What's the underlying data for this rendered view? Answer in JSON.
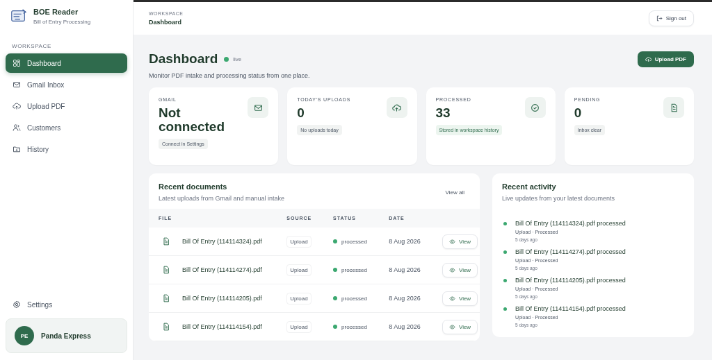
{
  "sidebar": {
    "app_name": "BOE Reader",
    "app_subtitle": "Bill of Entry Processing",
    "section": "WORKSPACE",
    "items": [
      {
        "label": "Dashboard",
        "selected": true
      },
      {
        "label": "Gmail Inbox",
        "selected": false
      },
      {
        "label": "Upload PDF",
        "selected": false
      },
      {
        "label": "Customers",
        "selected": false
      },
      {
        "label": "History",
        "selected": false
      }
    ],
    "settings": "Settings",
    "user": {
      "initials": "PE",
      "name": "Panda Express"
    }
  },
  "header": {
    "breadcrumb": "WORKSPACE",
    "page": "Dashboard",
    "sign_out": "Sign out"
  },
  "hero": {
    "title": "Dashboard",
    "status": "live",
    "subtitle": "Monitor PDF intake and processing status from one place.",
    "upload": "Upload PDF"
  },
  "stats": [
    {
      "label": "GMAIL",
      "value": "Not connected",
      "note": "Connect in Settings",
      "kind": "neutral"
    },
    {
      "label": "TODAY'S UPLOADS",
      "value": "0",
      "note": "No uploads today",
      "kind": "neutral"
    },
    {
      "label": "PROCESSED",
      "value": "33",
      "note": "Stored in workspace history",
      "kind": "positive"
    },
    {
      "label": "PENDING",
      "value": "0",
      "note": "Inbox clear",
      "kind": "neutral"
    }
  ],
  "documents": {
    "title": "Recent documents",
    "subtitle": "Latest uploads from Gmail and manual intake",
    "view_all": "View all",
    "columns": [
      "FILE",
      "SOURCE",
      "STATUS",
      "DATE"
    ],
    "rows": [
      {
        "file": "Bill Of Entry (114114324).pdf",
        "source": "Upload",
        "status": "processed",
        "date": "8 Aug 2026",
        "action": "View"
      },
      {
        "file": "Bill Of Entry (114114274).pdf",
        "source": "Upload",
        "status": "processed",
        "date": "8 Aug 2026",
        "action": "View"
      },
      {
        "file": "Bill Of Entry (114114205).pdf",
        "source": "Upload",
        "status": "processed",
        "date": "8 Aug 2026",
        "action": "View"
      },
      {
        "file": "Bill Of Entry (114114154).pdf",
        "source": "Upload",
        "status": "processed",
        "date": "8 Aug 2026",
        "action": "View"
      }
    ]
  },
  "activity": {
    "title": "Recent activity",
    "subtitle": "Live updates from your latest documents",
    "items": [
      {
        "title": "Bill Of Entry (114114324).pdf processed",
        "meta": "Upload · Processed",
        "time": "5 days ago"
      },
      {
        "title": "Bill Of Entry (114114274).pdf processed",
        "meta": "Upload · Processed",
        "time": "5 days ago"
      },
      {
        "title": "Bill Of Entry (114114205).pdf processed",
        "meta": "Upload · Processed",
        "time": "5 days ago"
      },
      {
        "title": "Bill Of Entry (114114154).pdf processed",
        "meta": "Upload · Processed",
        "time": "5 days ago"
      }
    ]
  }
}
